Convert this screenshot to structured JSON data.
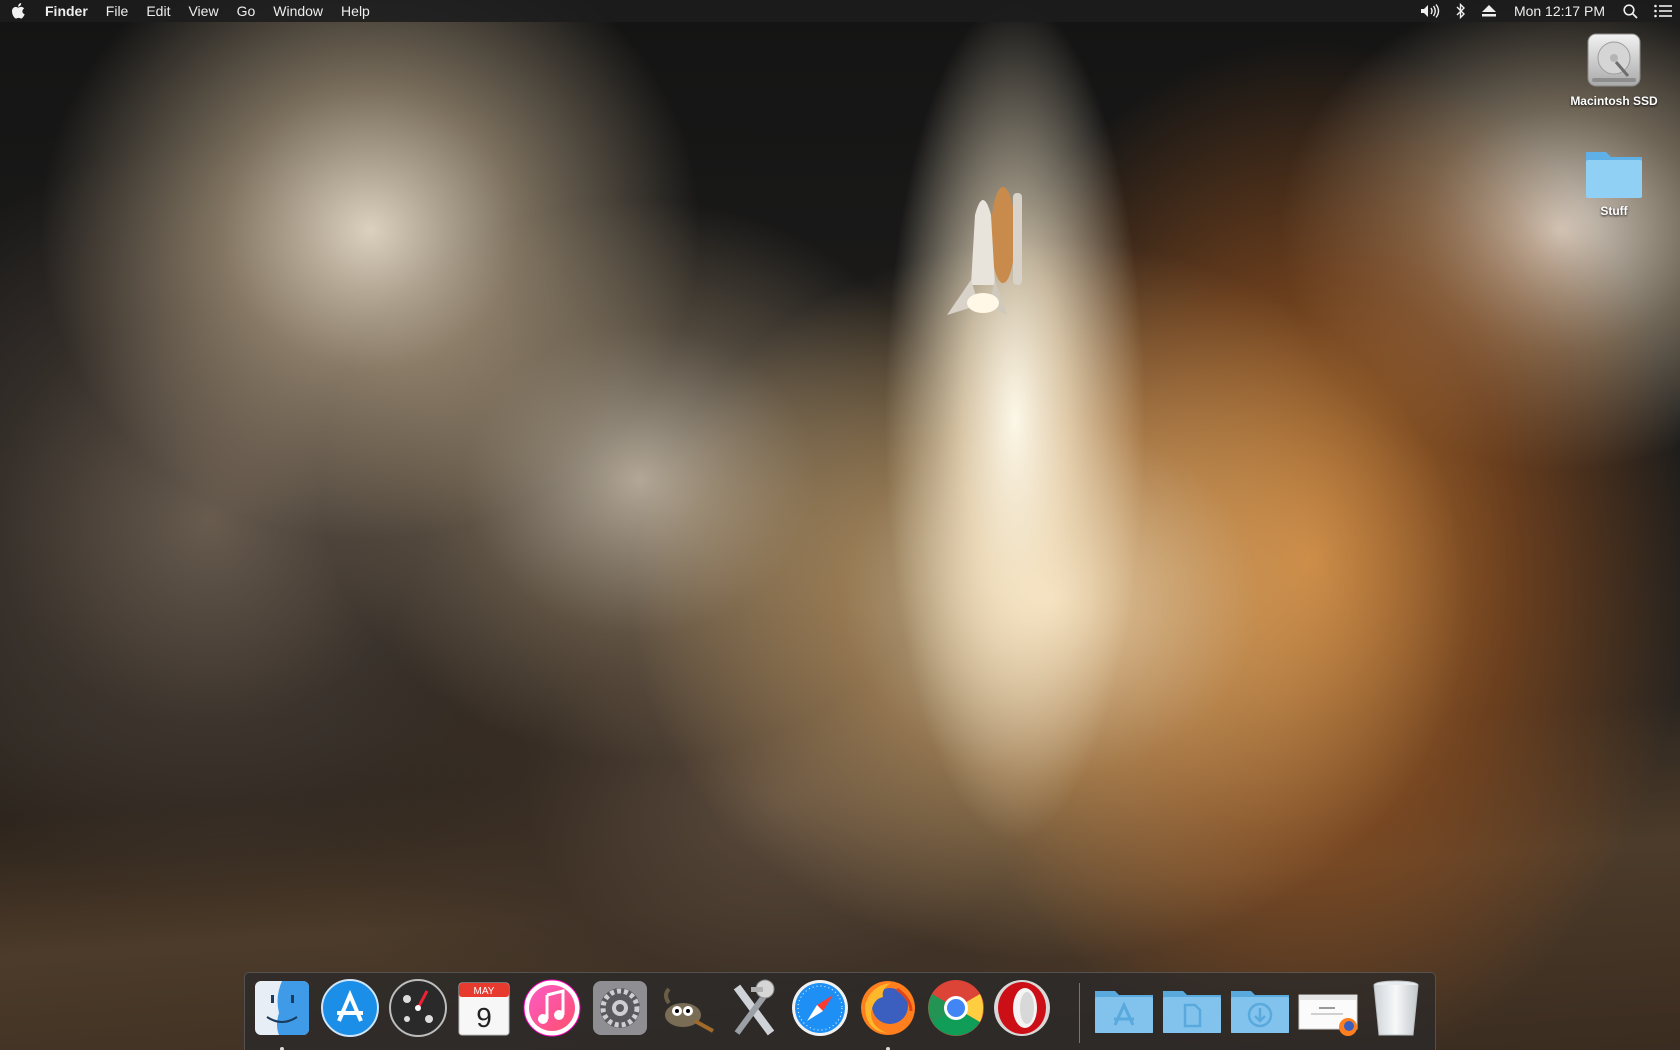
{
  "menubar": {
    "app_name": "Finder",
    "menus": [
      "File",
      "Edit",
      "View",
      "Go",
      "Window",
      "Help"
    ],
    "clock": "Mon 12:17 PM",
    "status_icons": [
      "volume-icon",
      "bluetooth-icon",
      "eject-icon",
      "spotlight-icon",
      "notification-center-icon"
    ]
  },
  "desktop_icons": [
    {
      "label": "Macintosh SSD",
      "icon": "hard-drive-icon"
    },
    {
      "label": "Stuff",
      "icon": "folder-icon"
    }
  ],
  "dock": {
    "calendar": {
      "month": "MAY",
      "day": "9"
    },
    "apps": [
      {
        "id": "finder",
        "icon": "finder-icon",
        "running": true
      },
      {
        "id": "app-store",
        "icon": "app-store-icon",
        "running": false
      },
      {
        "id": "dashboard",
        "icon": "dashboard-icon",
        "running": false
      },
      {
        "id": "calendar",
        "icon": "calendar-icon",
        "running": false
      },
      {
        "id": "itunes",
        "icon": "itunes-icon",
        "running": false
      },
      {
        "id": "system-preferences",
        "icon": "system-preferences-icon",
        "running": false
      },
      {
        "id": "gimp",
        "icon": "gimp-icon",
        "running": false
      },
      {
        "id": "x11",
        "icon": "x11-icon",
        "running": false
      },
      {
        "id": "safari",
        "icon": "safari-icon",
        "running": false
      },
      {
        "id": "firefox",
        "icon": "firefox-icon",
        "running": true
      },
      {
        "id": "chrome",
        "icon": "chrome-icon",
        "running": false
      },
      {
        "id": "opera",
        "icon": "opera-icon",
        "running": false
      }
    ],
    "stacks": [
      {
        "id": "applications",
        "icon": "applications-folder-icon"
      },
      {
        "id": "documents",
        "icon": "documents-folder-icon"
      },
      {
        "id": "downloads",
        "icon": "downloads-folder-icon"
      },
      {
        "id": "firefox-document",
        "icon": "firefox-document-icon"
      },
      {
        "id": "trash",
        "icon": "trash-icon"
      }
    ]
  },
  "colors": {
    "menubar_bg": "#1c1c1e",
    "folder_blue": "#7fc4ee",
    "dock_bg": "#28282a"
  }
}
